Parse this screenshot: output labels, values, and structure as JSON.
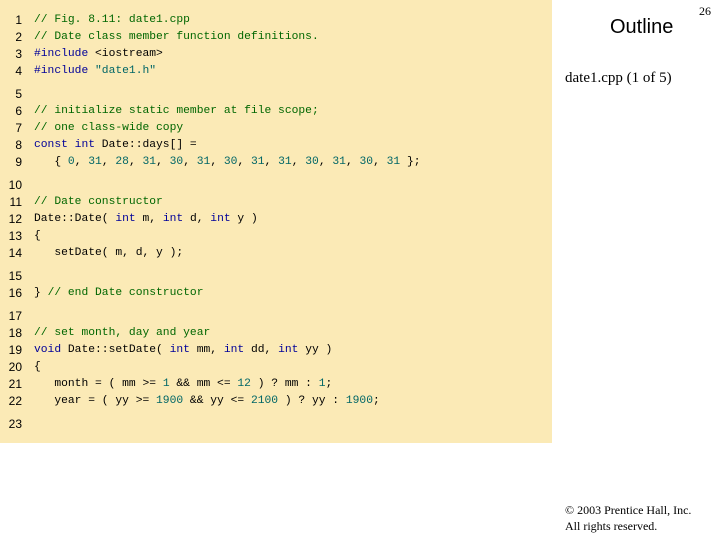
{
  "slide": {
    "page_number": "26",
    "outline_title": "Outline",
    "subtitle": "date1.cpp (1 of 5)",
    "copyright_line1": "© 2003 Prentice Hall, Inc.",
    "copyright_line2": "All rights reserved."
  },
  "colors": {
    "panel": "#fbeab6",
    "comment": "#006600",
    "keyword": "#000099",
    "number": "#006666"
  },
  "code_lines": [
    {
      "n": "1",
      "segs": [
        {
          "t": "// Fig. 8.11: date1.cpp",
          "c": "c"
        }
      ]
    },
    {
      "n": "2",
      "segs": [
        {
          "t": "// Date class member function definitions.",
          "c": "c"
        }
      ]
    },
    {
      "n": "3",
      "segs": [
        {
          "t": "#include",
          "c": "k"
        },
        {
          "t": " <iostream>",
          "c": "p"
        }
      ]
    },
    {
      "n": "4",
      "segs": [
        {
          "t": "#include",
          "c": "k"
        },
        {
          "t": " \"date1.h\"",
          "c": "n"
        }
      ]
    },
    {
      "n": "5",
      "segs": []
    },
    {
      "n": "6",
      "segs": [
        {
          "t": "// initialize static member at file scope;",
          "c": "c"
        }
      ]
    },
    {
      "n": "7",
      "segs": [
        {
          "t": "// one class-wide copy",
          "c": "c"
        }
      ]
    },
    {
      "n": "8",
      "segs": [
        {
          "t": "const int",
          "c": "k"
        },
        {
          "t": " Date::days[] =",
          "c": "p"
        }
      ]
    },
    {
      "n": "9",
      "segs": [
        {
          "t": "   { ",
          "c": "p"
        },
        {
          "t": "0",
          "c": "n"
        },
        {
          "t": ", ",
          "c": "p"
        },
        {
          "t": "31",
          "c": "n"
        },
        {
          "t": ", ",
          "c": "p"
        },
        {
          "t": "28",
          "c": "n"
        },
        {
          "t": ", ",
          "c": "p"
        },
        {
          "t": "31",
          "c": "n"
        },
        {
          "t": ", ",
          "c": "p"
        },
        {
          "t": "30",
          "c": "n"
        },
        {
          "t": ", ",
          "c": "p"
        },
        {
          "t": "31",
          "c": "n"
        },
        {
          "t": ", ",
          "c": "p"
        },
        {
          "t": "30",
          "c": "n"
        },
        {
          "t": ", ",
          "c": "p"
        },
        {
          "t": "31",
          "c": "n"
        },
        {
          "t": ", ",
          "c": "p"
        },
        {
          "t": "31",
          "c": "n"
        },
        {
          "t": ", ",
          "c": "p"
        },
        {
          "t": "30",
          "c": "n"
        },
        {
          "t": ", ",
          "c": "p"
        },
        {
          "t": "31",
          "c": "n"
        },
        {
          "t": ", ",
          "c": "p"
        },
        {
          "t": "30",
          "c": "n"
        },
        {
          "t": ", ",
          "c": "p"
        },
        {
          "t": "31",
          "c": "n"
        },
        {
          "t": " };",
          "c": "p"
        }
      ]
    },
    {
      "n": "10",
      "segs": []
    },
    {
      "n": "11",
      "segs": [
        {
          "t": "// Date constructor",
          "c": "c"
        }
      ]
    },
    {
      "n": "12",
      "segs": [
        {
          "t": "Date::Date( ",
          "c": "p"
        },
        {
          "t": "int",
          "c": "k"
        },
        {
          "t": " m, ",
          "c": "p"
        },
        {
          "t": "int",
          "c": "k"
        },
        {
          "t": " d, ",
          "c": "p"
        },
        {
          "t": "int",
          "c": "k"
        },
        {
          "t": " y )",
          "c": "p"
        }
      ]
    },
    {
      "n": "13",
      "segs": [
        {
          "t": "{",
          "c": "p"
        }
      ]
    },
    {
      "n": "14",
      "segs": [
        {
          "t": "   setDate( m, d, y );",
          "c": "p"
        }
      ]
    },
    {
      "n": "15",
      "segs": []
    },
    {
      "n": "16",
      "segs": [
        {
          "t": "} ",
          "c": "p"
        },
        {
          "t": "// end Date constructor",
          "c": "c"
        }
      ]
    },
    {
      "n": "17",
      "segs": []
    },
    {
      "n": "18",
      "segs": [
        {
          "t": "// set month, day and year",
          "c": "c"
        }
      ]
    },
    {
      "n": "19",
      "segs": [
        {
          "t": "void",
          "c": "k"
        },
        {
          "t": " Date::setDate( ",
          "c": "p"
        },
        {
          "t": "int",
          "c": "k"
        },
        {
          "t": " mm, ",
          "c": "p"
        },
        {
          "t": "int",
          "c": "k"
        },
        {
          "t": " dd, ",
          "c": "p"
        },
        {
          "t": "int",
          "c": "k"
        },
        {
          "t": " yy )",
          "c": "p"
        }
      ]
    },
    {
      "n": "20",
      "segs": [
        {
          "t": "{",
          "c": "p"
        }
      ]
    },
    {
      "n": "21",
      "segs": [
        {
          "t": "   month = ( mm >= ",
          "c": "p"
        },
        {
          "t": "1",
          "c": "n"
        },
        {
          "t": " && mm <= ",
          "c": "p"
        },
        {
          "t": "12",
          "c": "n"
        },
        {
          "t": " ) ? mm : ",
          "c": "p"
        },
        {
          "t": "1",
          "c": "n"
        },
        {
          "t": ";",
          "c": "p"
        }
      ]
    },
    {
      "n": "22",
      "segs": [
        {
          "t": "   year = ( yy >= ",
          "c": "p"
        },
        {
          "t": "1900",
          "c": "n"
        },
        {
          "t": " && yy <= ",
          "c": "p"
        },
        {
          "t": "2100",
          "c": "n"
        },
        {
          "t": " ) ? yy : ",
          "c": "p"
        },
        {
          "t": "1900",
          "c": "n"
        },
        {
          "t": ";",
          "c": "p"
        }
      ]
    },
    {
      "n": "23",
      "segs": []
    }
  ]
}
